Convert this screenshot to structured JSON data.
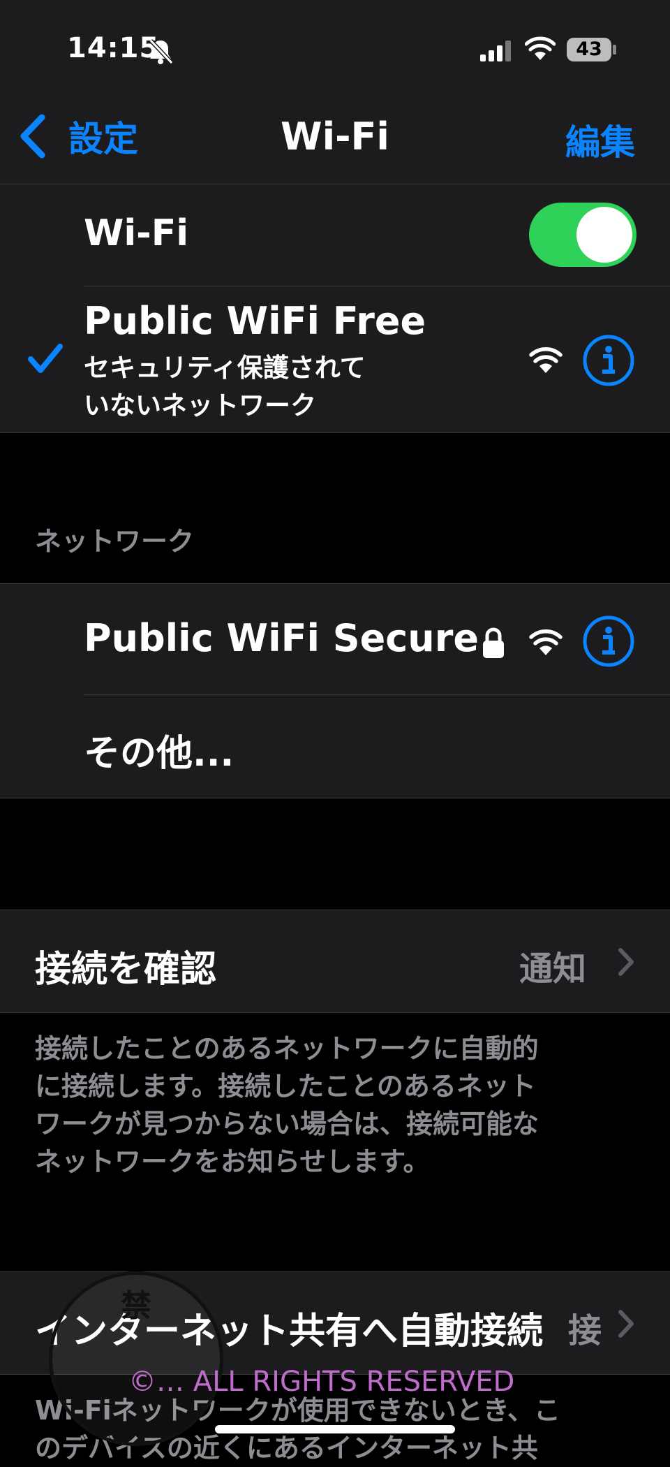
{
  "status_bar": {
    "time": "14:15",
    "battery": "43"
  },
  "nav": {
    "back_label": "設定",
    "title": "Wi-Fi",
    "edit_label": "編集"
  },
  "wifi_toggle": {
    "label": "Wi-Fi",
    "on": true
  },
  "current_network": {
    "name": "Public WiFi Free",
    "subtitle_line1": "セキュリティ保護されて",
    "subtitle_line2": "いないネットワーク"
  },
  "networks_section": {
    "header": "ネットワーク",
    "items": [
      {
        "name": "Public WiFi Secure",
        "locked": true
      }
    ],
    "other_label": "その他..."
  },
  "ask_to_join": {
    "label": "接続を確認",
    "value": "通知",
    "footer": [
      "接続したことのあるネットワークに自動的",
      "に接続します。接続したことのあるネット",
      "ワークが見つからない場合は、接続可能な",
      "ネットワークをお知らせします。"
    ]
  },
  "auto_hotspot": {
    "label": "インターネット共有へ自動接続",
    "value": "接",
    "footer_line1": "Wi-Fiネットワークが使用できないとき、こ",
    "footer_line2": "のデバイスの近くにあるインターネット共"
  },
  "watermark": {
    "text": "©… ALL RIGHTS RESERVED",
    "stamp_char": "禁"
  },
  "colors": {
    "accent": "#0a84ff",
    "toggle_on": "#30d158",
    "bg": "#000000",
    "cell": "#1c1c1e",
    "secondary": "#8d8d93"
  }
}
